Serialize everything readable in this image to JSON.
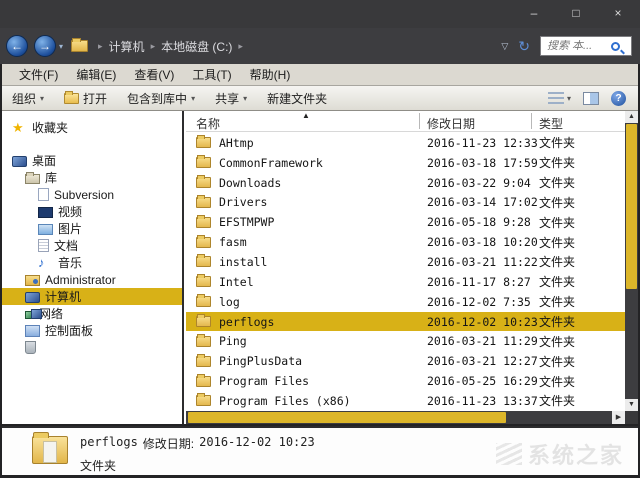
{
  "window": {
    "minimize": "–",
    "maximize": "□",
    "close": "×"
  },
  "address_bar": {
    "back": "←",
    "forward": "→",
    "breadcrumb_items": [
      "计算机",
      "本地磁盘 (C:)"
    ],
    "search_placeholder": "搜索 本..."
  },
  "menu_bar": {
    "items": [
      "文件(F)",
      "编辑(E)",
      "查看(V)",
      "工具(T)",
      "帮助(H)"
    ]
  },
  "toolbar": {
    "organize": "组织",
    "open": "打开",
    "include_in_library": "包含到库中",
    "share": "共享",
    "new_folder": "新建文件夹"
  },
  "sidebar": {
    "items": [
      {
        "id": "favorites",
        "label": "收藏夹",
        "icon": "star-icon",
        "depth": 0,
        "selected": false,
        "gap_after": true
      },
      {
        "id": "desktop",
        "label": "桌面",
        "icon": "desktop-icon",
        "depth": 0,
        "selected": false,
        "gap_after": false
      },
      {
        "id": "libraries",
        "label": "库",
        "icon": "libraries-icon",
        "depth": 1,
        "selected": false,
        "gap_after": false
      },
      {
        "id": "subversion",
        "label": "Subversion",
        "icon": "library-icon",
        "depth": 2,
        "selected": false,
        "gap_after": false
      },
      {
        "id": "videos",
        "label": "视频",
        "icon": "videos-icon",
        "depth": 2,
        "selected": false,
        "gap_after": false
      },
      {
        "id": "pictures",
        "label": "图片",
        "icon": "pictures-icon",
        "depth": 2,
        "selected": false,
        "gap_after": false
      },
      {
        "id": "documents",
        "label": "文档",
        "icon": "documents-icon",
        "depth": 2,
        "selected": false,
        "gap_after": false
      },
      {
        "id": "music",
        "label": "音乐",
        "icon": "music-icon",
        "depth": 2,
        "selected": false,
        "gap_after": false
      },
      {
        "id": "administrator",
        "label": "Administrator",
        "icon": "user-icon",
        "depth": 1,
        "selected": false,
        "gap_after": false
      },
      {
        "id": "computer",
        "label": "计算机",
        "icon": "computer-icon",
        "depth": 1,
        "selected": true,
        "gap_after": false
      },
      {
        "id": "network",
        "label": "网络",
        "icon": "network-icon",
        "depth": 1,
        "selected": false,
        "gap_after": false
      },
      {
        "id": "control-panel",
        "label": "控制面板",
        "icon": "control-panel-icon",
        "depth": 1,
        "selected": false,
        "gap_after": false
      },
      {
        "id": "recycle-bin",
        "label": "",
        "icon": "recycle-bin-icon",
        "depth": 1,
        "selected": false,
        "gap_after": false
      }
    ]
  },
  "file_list": {
    "columns": {
      "name": "名称",
      "date": "修改日期",
      "type": "类型"
    },
    "sort_arrow": "▲",
    "rows": [
      {
        "name": "AHtmp",
        "date": "2016-11-23 12:33",
        "type": "文件夹",
        "selected": false
      },
      {
        "name": "CommonFramework",
        "date": "2016-03-18 17:59",
        "type": "文件夹",
        "selected": false
      },
      {
        "name": "Downloads",
        "date": "2016-03-22 9:04",
        "type": "文件夹",
        "selected": false
      },
      {
        "name": "Drivers",
        "date": "2016-03-14 17:02",
        "type": "文件夹",
        "selected": false
      },
      {
        "name": "EFSTMPWP",
        "date": "2016-05-18 9:28",
        "type": "文件夹",
        "selected": false
      },
      {
        "name": "fasm",
        "date": "2016-03-18 10:20",
        "type": "文件夹",
        "selected": false
      },
      {
        "name": "install",
        "date": "2016-03-21 11:22",
        "type": "文件夹",
        "selected": false
      },
      {
        "name": "Intel",
        "date": "2016-11-17 8:27",
        "type": "文件夹",
        "selected": false
      },
      {
        "name": "log",
        "date": "2016-12-02 7:35",
        "type": "文件夹",
        "selected": false
      },
      {
        "name": "perflogs",
        "date": "2016-12-02 10:23",
        "type": "文件夹",
        "selected": true
      },
      {
        "name": "Ping",
        "date": "2016-03-21 11:29",
        "type": "文件夹",
        "selected": false
      },
      {
        "name": "PingPlusData",
        "date": "2016-03-21 12:27",
        "type": "文件夹",
        "selected": false
      },
      {
        "name": "Program Files",
        "date": "2016-05-25 16:29",
        "type": "文件夹",
        "selected": false
      },
      {
        "name": "Program Files (x86)",
        "date": "2016-11-23 13:37",
        "type": "文件夹",
        "selected": false
      }
    ]
  },
  "details_pane": {
    "title": "perflogs",
    "modified_label": "修改日期:",
    "modified": "2016-12-02 10:23",
    "type": "文件夹"
  },
  "watermark": {
    "text": "系统之家"
  },
  "colors": {
    "selection": "#d8b117",
    "scroll_thumb": "#dcb62a",
    "frame": "#3d3d40"
  }
}
